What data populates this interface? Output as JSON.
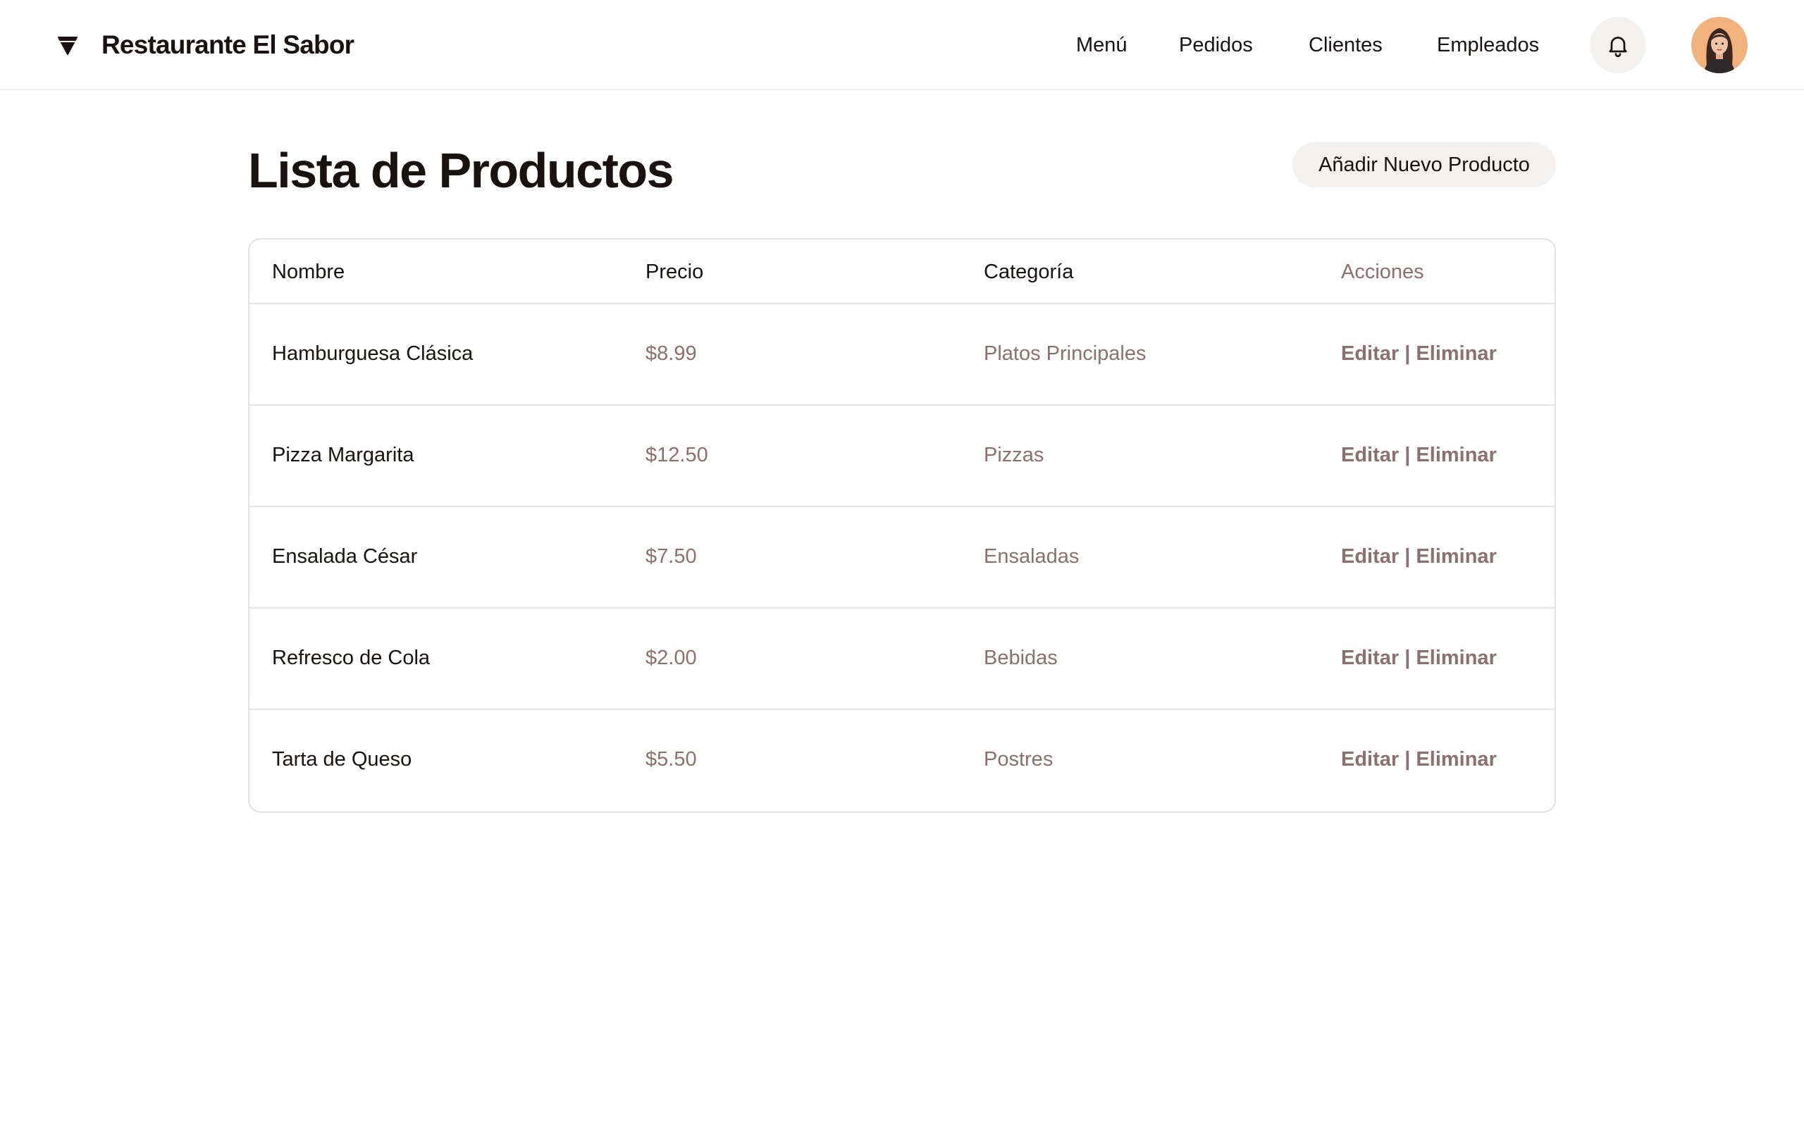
{
  "header": {
    "brand_title": "Restaurante El Sabor",
    "nav": [
      "Menú",
      "Pedidos",
      "Clientes",
      "Empleados"
    ]
  },
  "main": {
    "title": "Lista de Productos",
    "add_button": "Añadir Nuevo Producto"
  },
  "table": {
    "columns": {
      "name": "Nombre",
      "price": "Precio",
      "category": "Categoría",
      "actions": "Acciones"
    },
    "rows": [
      {
        "name": "Hamburguesa Clásica",
        "price": "$8.99",
        "category": "Platos Principales"
      },
      {
        "name": "Pizza Margarita",
        "price": "$12.50",
        "category": "Pizzas"
      },
      {
        "name": "Ensalada César",
        "price": "$7.50",
        "category": "Ensaladas"
      },
      {
        "name": "Refresco de Cola",
        "price": "$2.00",
        "category": "Bebidas"
      },
      {
        "name": "Tarta de Queso",
        "price": "$5.50",
        "category": "Postres"
      }
    ],
    "edit_label": "Editar",
    "separator": " | ",
    "delete_label": "Eliminar"
  },
  "icons": {
    "brand": "diamond-logo-icon",
    "notifications": "bell-icon",
    "avatar": "user-avatar"
  },
  "colors": {
    "text": "#181311",
    "muted": "#8a7170",
    "border": "#e6e0df",
    "button_bg": "#f4f2f1",
    "avatar_bg": "#f1b27d"
  }
}
